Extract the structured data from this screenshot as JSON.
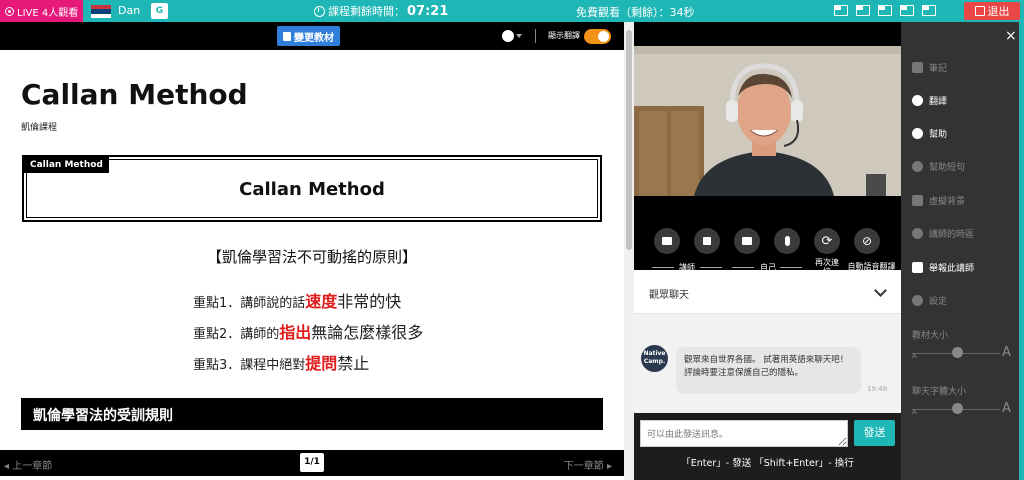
{
  "topbar": {
    "live_label": "LIVE 4人觀看",
    "tutor_name": "Dan",
    "translate_icon": "G",
    "timer_label": "課程剩餘時間：",
    "timer_value": "07:21",
    "free_watch": "免費觀看（剩餘）：34秒",
    "exit_label": "退出",
    "accent_color": "#1eb7b5",
    "live_color": "#e6197a",
    "exit_color": "#e94646"
  },
  "lesson": {
    "change_material": "變更教材",
    "show_translation": "顯示翻譯",
    "title": "Callan Method",
    "subtitle": "凱倫課程",
    "box_tag": "Callan Method",
    "box_title": "Callan Method",
    "principles_title": "【凱倫學習法不可動搖的原則】",
    "points": [
      {
        "prefix": "重點1．講師說的話",
        "highlight": "速度",
        "suffix": "非常的快"
      },
      {
        "prefix": "重點2．講師的",
        "highlight": "指出",
        "suffix": "無論怎麼樣很多"
      },
      {
        "prefix": "重點3．課程中絕對",
        "highlight": "提問",
        "suffix": "禁止"
      }
    ],
    "rules_heading": "凱倫學習法的受訓規則",
    "prev_chapter": "上一章節",
    "next_chapter": "下一章節",
    "page_indicator": "1/1"
  },
  "video": {
    "controls_tutor": "講師",
    "controls_self": "自己",
    "reconnect": "再次連接",
    "auto_translate": "自動語音翻譯"
  },
  "chat": {
    "title": "觀眾聊天",
    "avatar_text": "Native Camp.",
    "message": "觀眾來自世界各國。 試著用英語來聊天吧！評論時要注意保護自己的隱私。",
    "time": "19:48",
    "placeholder": "可以由此發送訊息。",
    "send_label": "發送",
    "hint": "「Enter」- 發送 「Shift+Enter」- 換行"
  },
  "menu": {
    "close": "×",
    "items": [
      {
        "label": "筆記",
        "icon": "note-icon",
        "active": false
      },
      {
        "label": "翻譯",
        "icon": "globe-icon",
        "active": true
      },
      {
        "label": "幫助",
        "icon": "help-icon",
        "active": true
      },
      {
        "label": "幫助短句",
        "icon": "chat-bubble-icon",
        "active": false
      },
      {
        "label": "虛擬背景",
        "icon": "image-icon",
        "active": false
      },
      {
        "label": "講師的時區",
        "icon": "timezone-icon",
        "active": false
      },
      {
        "label": "舉報此講師",
        "icon": "flag-icon",
        "active": true
      },
      {
        "label": "設定",
        "icon": "gear-icon",
        "active": false
      }
    ],
    "material_size": "教材大小",
    "chat_font_size": "聊天字體大小",
    "size_small": "A",
    "size_big": "A"
  }
}
